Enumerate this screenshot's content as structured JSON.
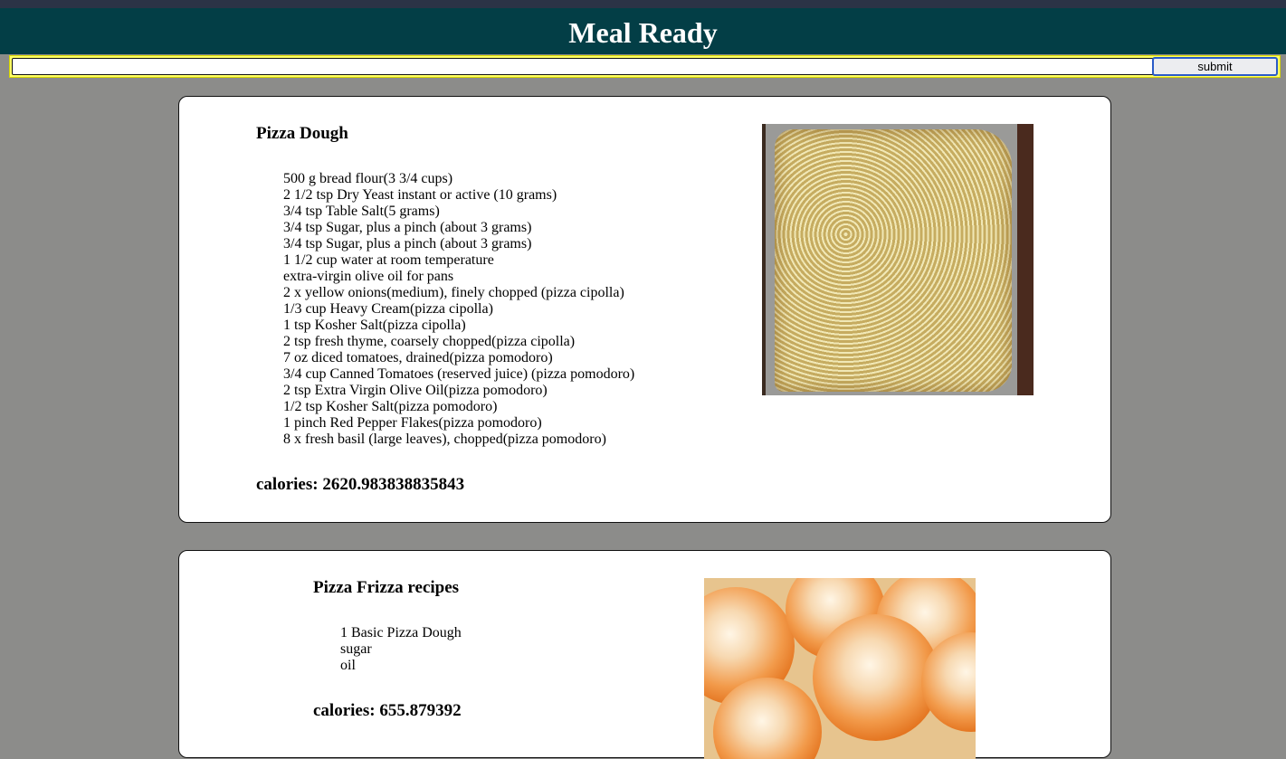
{
  "app": {
    "title": "Meal Ready"
  },
  "search": {
    "value": "",
    "placeholder": "",
    "submit_label": "submit"
  },
  "recipes": [
    {
      "title": "Pizza Dough",
      "ingredients": [
        "500 g bread flour(3 3/4 cups)",
        "2 1/2 tsp Dry Yeast instant or active (10 grams)",
        "3/4 tsp Table Salt(5 grams)",
        "3/4 tsp Sugar, plus a pinch (about 3 grams)",
        "3/4 tsp Sugar, plus a pinch (about 3 grams)",
        "1 1/2 cup water at room temperature",
        "extra-virgin olive oil for pans",
        "2 x yellow onions(medium), finely chopped (pizza cipolla)",
        "1/3 cup Heavy Cream(pizza cipolla)",
        "1 tsp Kosher Salt(pizza cipolla)",
        "2 tsp fresh thyme, coarsely chopped(pizza cipolla)",
        "7 oz diced tomatoes, drained(pizza pomodoro)",
        "3/4 cup Canned Tomatoes (reserved juice) (pizza pomodoro)",
        "2 tsp Extra Virgin Olive Oil(pizza pomodoro)",
        "1/2 tsp Kosher Salt(pizza pomodoro)",
        "1 pinch Red Pepper Flakes(pizza pomodoro)",
        "8 x fresh basil (large leaves), chopped(pizza pomodoro)"
      ],
      "calories": "calories: 2620.983838835843"
    },
    {
      "title": "Pizza Frizza recipes",
      "ingredients": [
        "1 Basic Pizza Dough",
        "sugar",
        "oil"
      ],
      "calories": "calories: 655.879392"
    }
  ],
  "colors": {
    "header_bg": "#033e46",
    "page_bg": "#8c8c8a",
    "search_border": "#ffff66",
    "submit_focus": "#2a5bc8"
  }
}
